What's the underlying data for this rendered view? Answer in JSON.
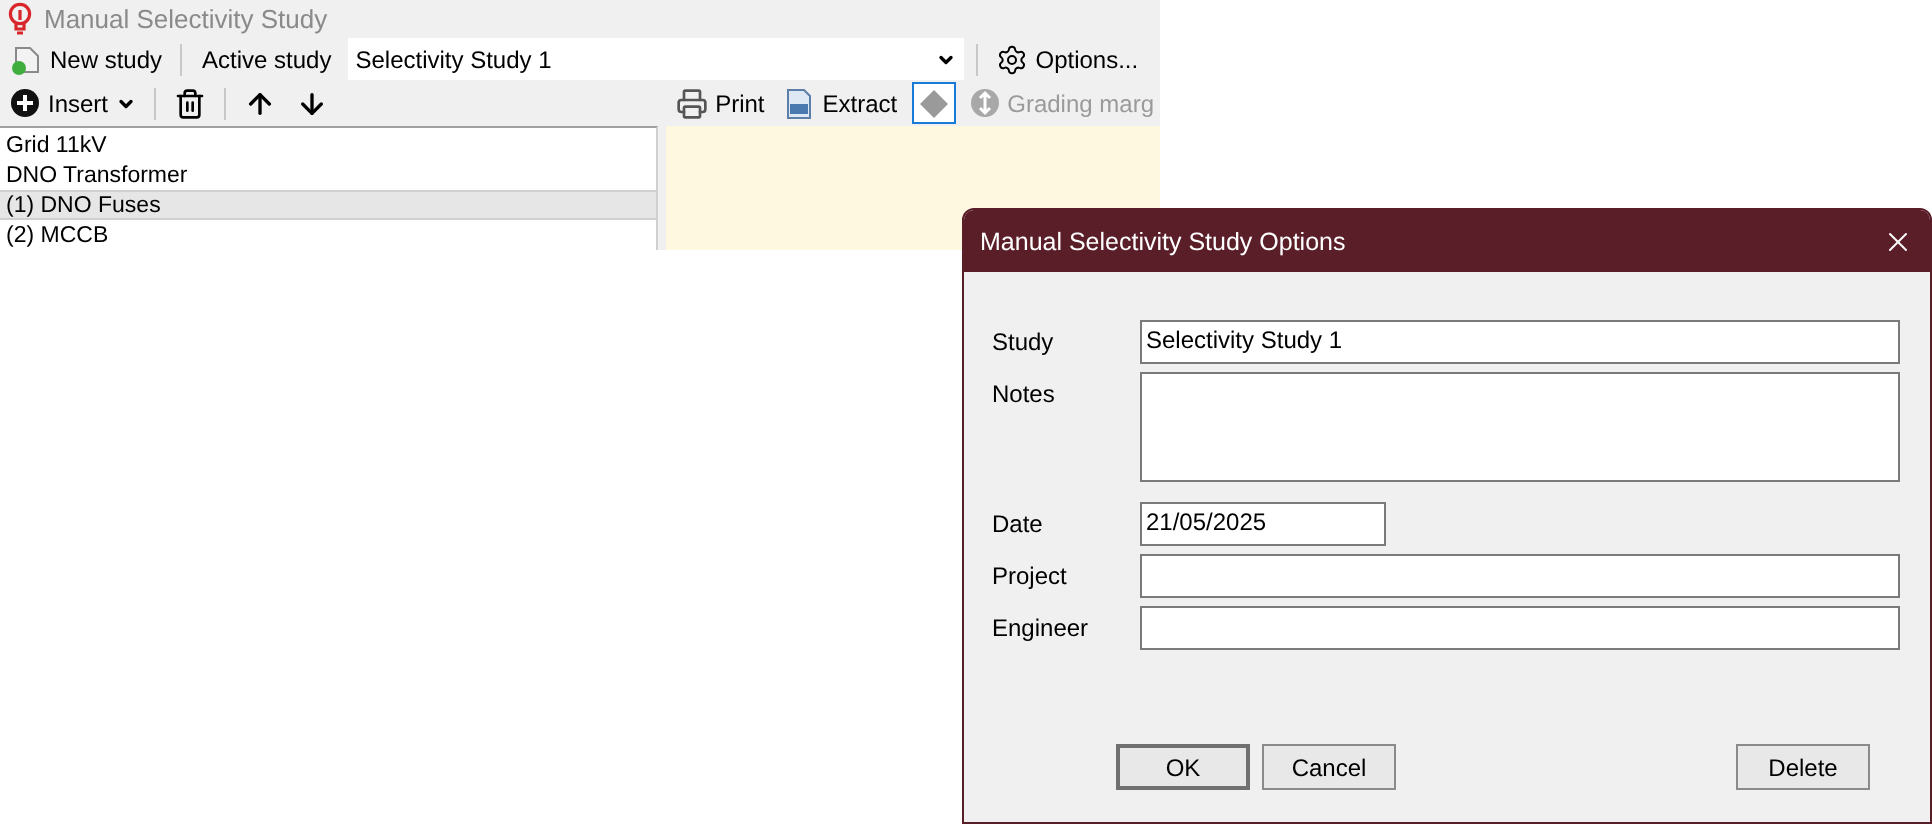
{
  "app": {
    "title": "Manual Selectivity Study",
    "toolbar": {
      "new_study": "New study",
      "active_study_label": "Active study",
      "active_study": "Selectivity Study 1",
      "options": "Options..."
    },
    "list_toolbar": {
      "insert": "Insert"
    },
    "chart_toolbar": [
      {
        "kind": "print",
        "label": "Print",
        "disabled": false
      },
      {
        "kind": "extract",
        "label": "Extract",
        "disabled": false
      },
      {
        "kind": "toggle",
        "selected": true
      },
      {
        "kind": "grading",
        "label": "Grading marg",
        "disabled": true
      }
    ],
    "items": [
      {
        "label": "Grid 11kV",
        "selected": false
      },
      {
        "label": "DNO Transformer",
        "selected": false
      },
      {
        "label": "(1) DNO Fuses",
        "selected": true
      },
      {
        "label": "(2) MCCB",
        "selected": false
      }
    ]
  },
  "dialog": {
    "title": "Manual Selectivity Study Options",
    "fields": [
      {
        "label": "Study",
        "value": "Selectivity Study 1",
        "kind": "line"
      },
      {
        "label": "Notes",
        "kind": "multiline"
      },
      {
        "label": "Date",
        "value": "21/05/2025",
        "kind": "short"
      },
      {
        "label": "Project",
        "kind": "line"
      },
      {
        "label": "Engineer",
        "kind": "line"
      }
    ],
    "buttons": [
      {
        "label": "OK",
        "default": true
      },
      {
        "label": "Cancel",
        "default": false
      }
    ],
    "end_buttons": [
      {
        "label": "Delete",
        "default": false
      }
    ]
  }
}
